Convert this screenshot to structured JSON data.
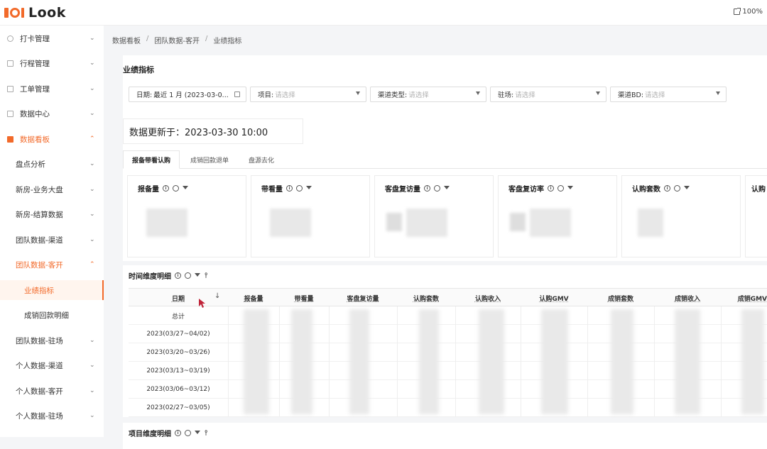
{
  "app": {
    "logo_text": "Look",
    "zoom": "100%"
  },
  "sidebar": {
    "items": [
      {
        "label": "打卡管理",
        "chevron": "⌄"
      },
      {
        "label": "行程管理",
        "chevron": "⌄"
      },
      {
        "label": "工单管理",
        "chevron": "⌄"
      },
      {
        "label": "数据中心",
        "chevron": "⌄"
      },
      {
        "label": "数据看板",
        "chevron": "⌃"
      },
      {
        "label": "盘点分析",
        "chevron": "⌄"
      },
      {
        "label": "新房-业务大盘",
        "chevron": "⌄"
      },
      {
        "label": "新房-结算数据",
        "chevron": "⌄"
      },
      {
        "label": "团队数据-渠道",
        "chevron": "⌄"
      },
      {
        "label": "团队数据-客开",
        "chevron": "⌃"
      },
      {
        "label": "业绩指标"
      },
      {
        "label": "成销回款明细"
      },
      {
        "label": "团队数据-驻场",
        "chevron": "⌄"
      },
      {
        "label": "个人数据-渠道",
        "chevron": "⌄"
      },
      {
        "label": "个人数据-客开",
        "chevron": "⌄"
      },
      {
        "label": "个人数据-驻场",
        "chevron": "⌄"
      }
    ]
  },
  "breadcrumb": {
    "items": [
      "数据看板",
      "团队数据-客开",
      "业绩指标"
    ],
    "separator": "/"
  },
  "page": {
    "title": "业绩指标"
  },
  "filters": {
    "date": {
      "label": "日期:",
      "value": "最近 1 月 (2023-03-0..."
    },
    "project": {
      "label": "项目:",
      "placeholder": "请选择"
    },
    "channel_type": {
      "label": "渠道类型:",
      "placeholder": "请选择"
    },
    "site": {
      "label": "驻场:",
      "placeholder": "请选择"
    },
    "channel_bd": {
      "label": "渠道BD:",
      "placeholder": "请选择"
    }
  },
  "update": {
    "text": "数据更新于：2023-03-30 10:00"
  },
  "tabs": [
    "报备带看认购",
    "成销回款退单",
    "盘源去化"
  ],
  "metrics": [
    "报备量",
    "带看量",
    "客盘复访量",
    "客盘复访率",
    "认购套数",
    "认购"
  ],
  "time_detail": {
    "title": "时间维度明细",
    "columns": [
      "日期",
      "报备量",
      "带看量",
      "客盘复访量",
      "认购套数",
      "认购收入",
      "认购GMV",
      "成销套数",
      "成销收入",
      "成销GMV"
    ],
    "rows": [
      "总计",
      "2023(03/27~04/02)",
      "2023(03/20~03/26)",
      "2023(03/13~03/19)",
      "2023(03/06~03/12)",
      "2023(02/27~03/05)"
    ]
  },
  "project_detail": {
    "title": "项目维度明细"
  },
  "icons": {
    "info": "i",
    "pin": "⫯",
    "sort": "↓"
  },
  "colors": {
    "accent": "#f26a2a"
  }
}
